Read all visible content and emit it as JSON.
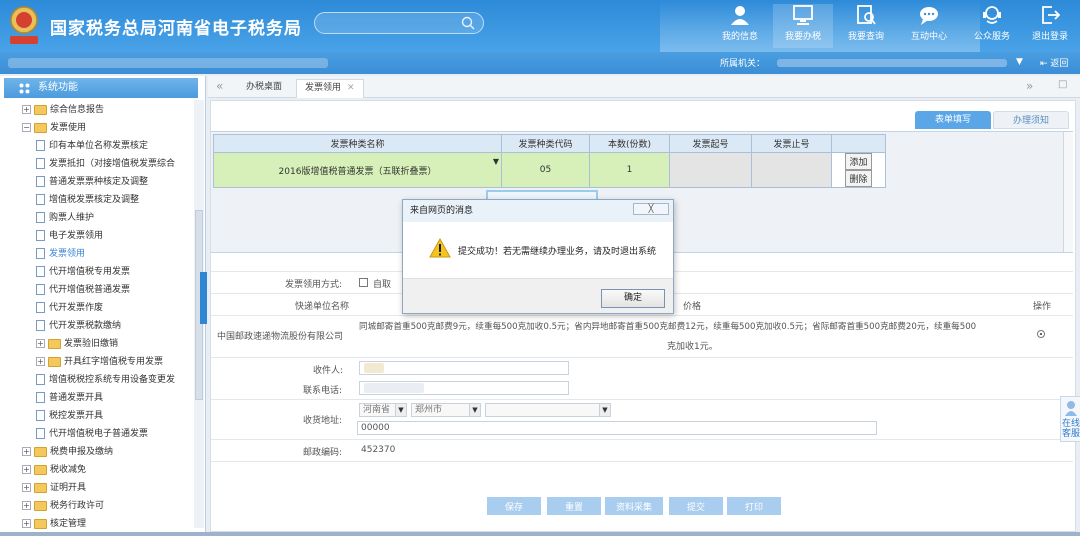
{
  "header": {
    "title": "国家税务总局河南省电子税务局",
    "nav": [
      {
        "label": "我的信息",
        "icon": "user-icon"
      },
      {
        "label": "我要办税",
        "icon": "monitor-icon"
      },
      {
        "label": "我要查询",
        "icon": "query-icon"
      },
      {
        "label": "互动中心",
        "icon": "chat-icon"
      },
      {
        "label": "公众服务",
        "icon": "service-icon"
      },
      {
        "label": "退出登录",
        "icon": "logout-icon"
      }
    ]
  },
  "subbar": {
    "org_label": "所属机关：",
    "back_label": "返回"
  },
  "sidebar": {
    "heading": "系统功能",
    "items": [
      {
        "label": "综合信息报告",
        "type": "folder",
        "expander": "+",
        "indent": 0
      },
      {
        "label": "发票使用",
        "type": "folder",
        "expander": "−",
        "indent": 0
      },
      {
        "label": "印有本单位名称发票核定",
        "type": "doc",
        "indent": 1
      },
      {
        "label": "发票抵扣（对接增值税发票综合",
        "type": "doc",
        "indent": 1
      },
      {
        "label": "普通发票票种核定及调整",
        "type": "doc",
        "indent": 1
      },
      {
        "label": "增值税发票核定及调整",
        "type": "doc",
        "indent": 1
      },
      {
        "label": "购票人维护",
        "type": "doc",
        "indent": 1
      },
      {
        "label": "电子发票领用",
        "type": "doc",
        "indent": 1
      },
      {
        "label": "发票领用",
        "type": "doc",
        "indent": 1,
        "selected": true
      },
      {
        "label": "代开增值税专用发票",
        "type": "doc",
        "indent": 1
      },
      {
        "label": "代开增值税普通发票",
        "type": "doc",
        "indent": 1
      },
      {
        "label": "代开发票作废",
        "type": "doc",
        "indent": 1
      },
      {
        "label": "代开发票税款缴纳",
        "type": "doc",
        "indent": 1
      },
      {
        "label": "发票验旧缴销",
        "type": "folder",
        "expander": "+",
        "indent": 1
      },
      {
        "label": "开具红字增值税专用发票",
        "type": "folder",
        "expander": "+",
        "indent": 1
      },
      {
        "label": "增值税税控系统专用设备变更发",
        "type": "doc",
        "indent": 1
      },
      {
        "label": "普通发票开具",
        "type": "doc",
        "indent": 1
      },
      {
        "label": "税控发票开具",
        "type": "doc",
        "indent": 1
      },
      {
        "label": "代开增值税电子普通发票",
        "type": "doc",
        "indent": 1
      },
      {
        "label": "税费申报及缴纳",
        "type": "folder",
        "expander": "+",
        "indent": 0
      },
      {
        "label": "税收减免",
        "type": "folder",
        "expander": "+",
        "indent": 0
      },
      {
        "label": "证明开具",
        "type": "folder",
        "expander": "+",
        "indent": 0
      },
      {
        "label": "税务行政许可",
        "type": "folder",
        "expander": "+",
        "indent": 0
      },
      {
        "label": "核定管理",
        "type": "folder",
        "expander": "+",
        "indent": 0
      }
    ]
  },
  "tabs": {
    "prev": "«",
    "next": "»",
    "items": [
      {
        "label": "办税桌面",
        "active": false
      },
      {
        "label": "发票领用",
        "active": true,
        "closable": true
      }
    ]
  },
  "form_tabs": [
    "表单填写",
    "办理须知"
  ],
  "invoice_table": {
    "headers": [
      "发票种类名称",
      "发票种类代码",
      "本数(份数)",
      "发票起号",
      "发票止号"
    ],
    "row": {
      "name": "2016版增值税普通发票（五联折叠票）",
      "code": "05",
      "count": "1",
      "start_no": "",
      "end_no": ""
    },
    "add_label": "添加",
    "delete_label": "删除"
  },
  "form": {
    "method_label": "发票领用方式:",
    "method_option": "自取",
    "courier_col_label": "快递单位名称",
    "price_col_label": "价格",
    "op_col_label": "操作",
    "courier_name": "中国邮政速递物流股份有限公司",
    "price_text_1": "同城邮寄首重500克邮费9元，续重每500克加收0.5元；省内异地邮寄首重500克邮费12元，续重每500克加收0.5元；省际邮寄首重500克邮费20元，续重每500",
    "price_text_2": "克加收1元。",
    "recipient_label": "收件人:",
    "phone_label": "联系电话:",
    "address_label": "收货地址:",
    "province": "河南省",
    "city": "郑州市",
    "address_detail": "00000",
    "postcode_label": "邮政编码:",
    "postcode": "452370"
  },
  "buttons": [
    "保存",
    "重置",
    "资料采集",
    "提交",
    "打印"
  ],
  "dialog": {
    "title": "来自网页的消息",
    "close_label": "╳",
    "message": "提交成功！若无需继续办理业务，请及时退出系统",
    "ok_label": "确定"
  },
  "float_help": {
    "text": "在线客服"
  },
  "colors": {
    "header": "#2d8ad8",
    "selected_row": "#d7f0b9",
    "accent": "#3a86d6"
  }
}
